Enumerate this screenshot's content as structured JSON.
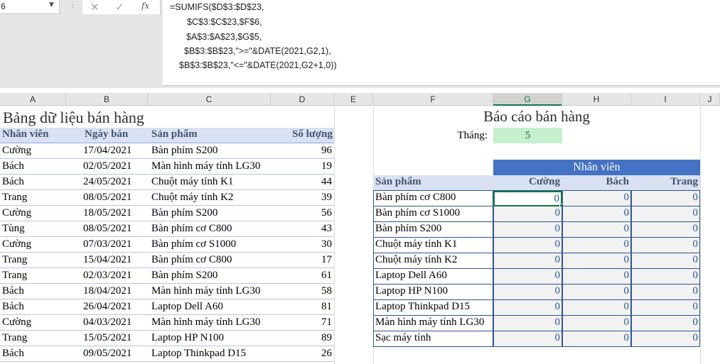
{
  "formula_bar": {
    "name_box": "6",
    "cancel_icon": "close-icon",
    "enter_icon": "check-icon",
    "fx_label": "fx",
    "lines": [
      "=SUMIFS($D$3:$D$23,",
      "$C$3:$C$23,$F$6,",
      "$A$3:$A$23,$G$5,",
      "$B$3:$B$23,\">=\"&DATE(2021,G2,1),",
      "$B$3:$B$23,\"<=\"&DATE(2021,G2+1,0))"
    ]
  },
  "columns": [
    "A",
    "B",
    "C",
    "D",
    "E",
    "F",
    "G",
    "H",
    "I",
    "J"
  ],
  "selected_column": "G",
  "data_table": {
    "title": "Bảng dữ liệu bán hàng",
    "headers": [
      "Nhân viên",
      "Ngày bán",
      "Sản phẩm",
      "Số lượng"
    ],
    "rows": [
      [
        "Cường",
        "17/04/2021",
        "Bàn phím S200",
        "96"
      ],
      [
        "Bách",
        "02/05/2021",
        "Màn hình máy tính LG30",
        "19"
      ],
      [
        "Bách",
        "24/05/2021",
        "Chuột máy tính K1",
        "44"
      ],
      [
        "Trang",
        "08/05/2021",
        "Chuột máy tính K2",
        "39"
      ],
      [
        "Cường",
        "18/05/2021",
        "Bàn phím S200",
        "56"
      ],
      [
        "Tùng",
        "08/05/2021",
        "Bàn phím cơ C800",
        "43"
      ],
      [
        "Cường",
        "07/03/2021",
        "Bàn phím cơ S1000",
        "30"
      ],
      [
        "Trang",
        "15/04/2021",
        "Bàn phím cơ C800",
        "17"
      ],
      [
        "Trang",
        "02/03/2021",
        "Bàn phím S200",
        "61"
      ],
      [
        "Bách",
        "18/04/2021",
        "Màn hình máy tính LG30",
        "58"
      ],
      [
        "Bách",
        "26/04/2021",
        "Laptop Dell A60",
        "81"
      ],
      [
        "Cường",
        "04/03/2021",
        "Màn hình máy tính LG30",
        "71"
      ],
      [
        "Trang",
        "15/05/2021",
        "Laptop HP N100",
        "89"
      ],
      [
        "Bách",
        "09/05/2021",
        "Laptop Thinkpad D15",
        "26"
      ]
    ]
  },
  "report": {
    "title": "Báo cáo bán hàng",
    "month_label": "Tháng:",
    "month_value": "5",
    "group_header": "Nhân viên",
    "product_header": "Sản phẩm",
    "employees": [
      "Cường",
      "Bách",
      "Trang"
    ],
    "products": [
      "Bàn phím cơ C800",
      "Bàn phím cơ S1000",
      "Bàn phím S200",
      "Chuột máy tính K1",
      "Chuột máy tính K2",
      "Laptop Dell A60",
      "Laptop HP N100",
      "Laptop Thinkpad D15",
      "Màn hình máy tính LG30",
      "Sạc máy tính"
    ],
    "values": [
      [
        "0",
        "0",
        "0"
      ],
      [
        "0",
        "0",
        "0"
      ],
      [
        "0",
        "0",
        "0"
      ],
      [
        "0",
        "0",
        "0"
      ],
      [
        "0",
        "0",
        "0"
      ],
      [
        "0",
        "0",
        "0"
      ],
      [
        "0",
        "0",
        "0"
      ],
      [
        "0",
        "0",
        "0"
      ],
      [
        "0",
        "0",
        "0"
      ],
      [
        "0",
        "0",
        "0"
      ]
    ]
  },
  "colors": {
    "header_band": "#d9e1f2",
    "report_header": "#4472c4",
    "month_fill": "#c6efce",
    "selection": "#107c41",
    "value_text": "#2f5597"
  }
}
